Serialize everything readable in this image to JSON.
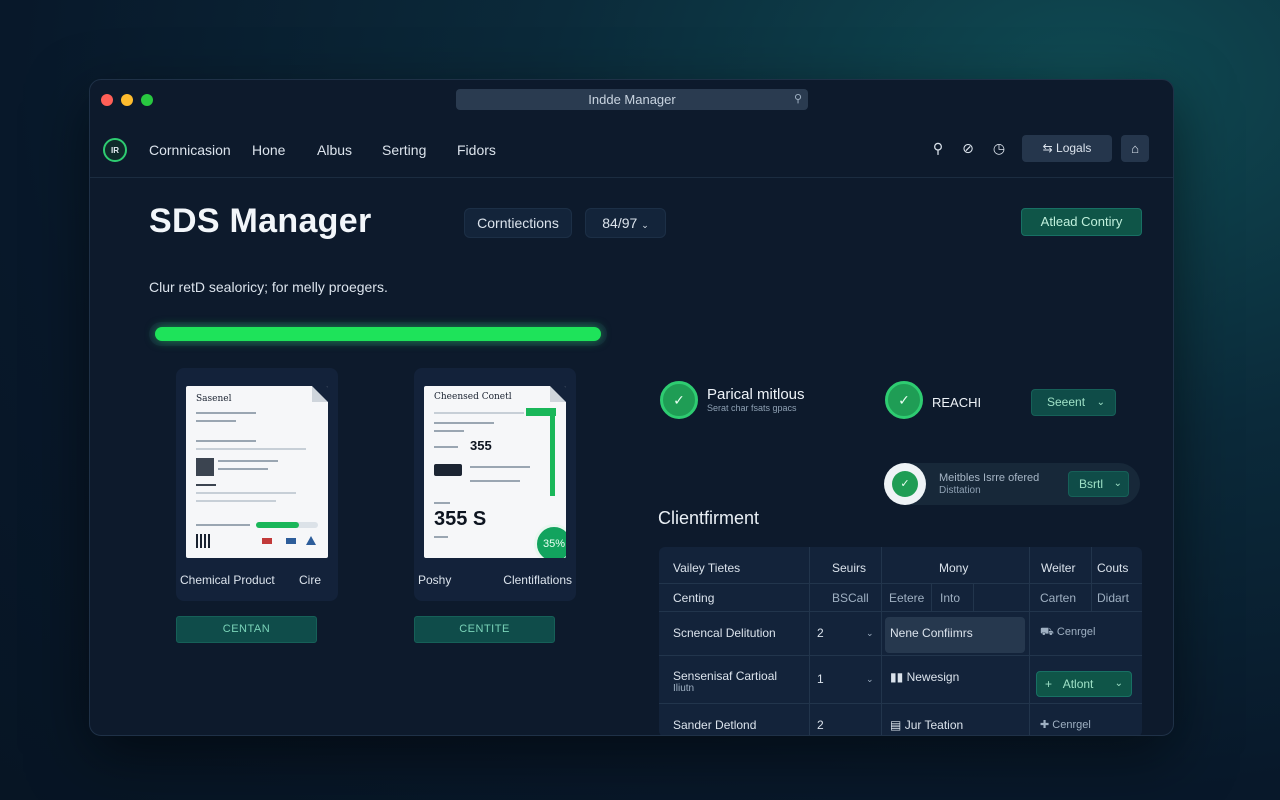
{
  "window": {
    "url_title": "Indde Manager"
  },
  "nav": {
    "logo_text": "IR",
    "items": [
      "Cornnicasion",
      "Hone",
      "Albus",
      "Serting",
      "Fidors"
    ],
    "logout_label": "Logals"
  },
  "header": {
    "title": "SDS Manager",
    "filter_label": "Corntiections",
    "range_label": "84/97",
    "add_button": "Atlead Contiry",
    "subtitle": "Clur retD sealoricy; for melly proegers."
  },
  "progress": {
    "value": 1.0
  },
  "cards": [
    {
      "doc_title": "Sasenel",
      "label_left": "Chemical Product",
      "label_right": "Cire",
      "button": "CENTAN"
    },
    {
      "doc_title": "Cheensed Conetl",
      "doc_number": "355",
      "doc_big": "355 S",
      "badge": "35%",
      "label_left": "Poshy",
      "label_right": "Clentiflations",
      "button": "CENTITE"
    }
  ],
  "status": {
    "item1_title": "Parical mitlous",
    "item1_sub": "Serat char fsats gpacs",
    "item2_title": "REACHI",
    "select_label": "Seeent",
    "dist_line1": "Meitbles Isrre ofered",
    "dist_line2": "Disttation",
    "dist_button": "Bsrtl"
  },
  "client": {
    "title": "Clientfirment",
    "headers": [
      "Vailey Tietes",
      "Seuirs",
      "Mony",
      "Weiter",
      "Couts"
    ],
    "subheaders": [
      "Centing",
      "BSCall",
      "Eetere",
      "Into",
      "Carten",
      "Didart"
    ],
    "rows": [
      {
        "name": "Scnencal Delitution",
        "qty": "2",
        "status": "Nene Confiimrs",
        "action": "Cenrgel"
      },
      {
        "name": "Sensenisaf Cartioal",
        "name2": "Iliutn",
        "qty": "1",
        "status": "Newesign",
        "action": "Atlont"
      },
      {
        "name": "Sander Detlond",
        "qty": "2",
        "status": "Jur Teation",
        "action": "Cenrgel"
      }
    ]
  }
}
